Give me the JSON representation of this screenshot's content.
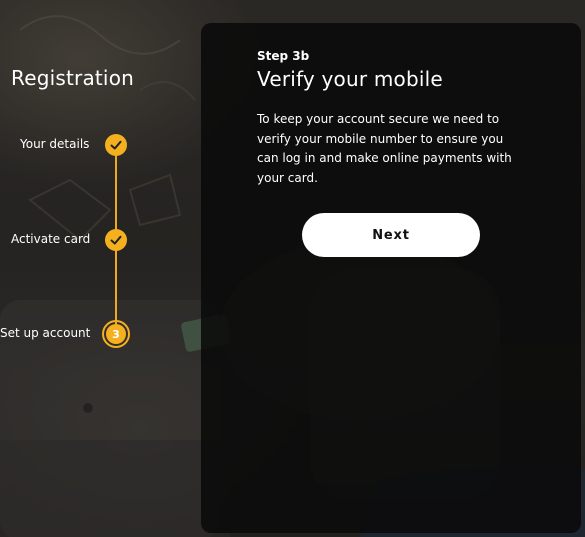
{
  "registration": {
    "title": "Registration",
    "steps": [
      {
        "label": "Your details",
        "status": "complete",
        "icon": "check-icon"
      },
      {
        "label": "Activate card",
        "status": "complete",
        "icon": "check-icon"
      },
      {
        "label": "Set up account",
        "status": "current",
        "number": "3"
      }
    ]
  },
  "panel": {
    "kicker": "Step 3b",
    "title": "Verify your mobile",
    "body": "To keep your account secure we need to verify your mobile number to ensure you can log in and make online payments with your card.",
    "next_label": "Next"
  },
  "colors": {
    "accent": "#f5b020",
    "panel_bg": "#0a0a0a",
    "button_bg": "#ffffff"
  }
}
